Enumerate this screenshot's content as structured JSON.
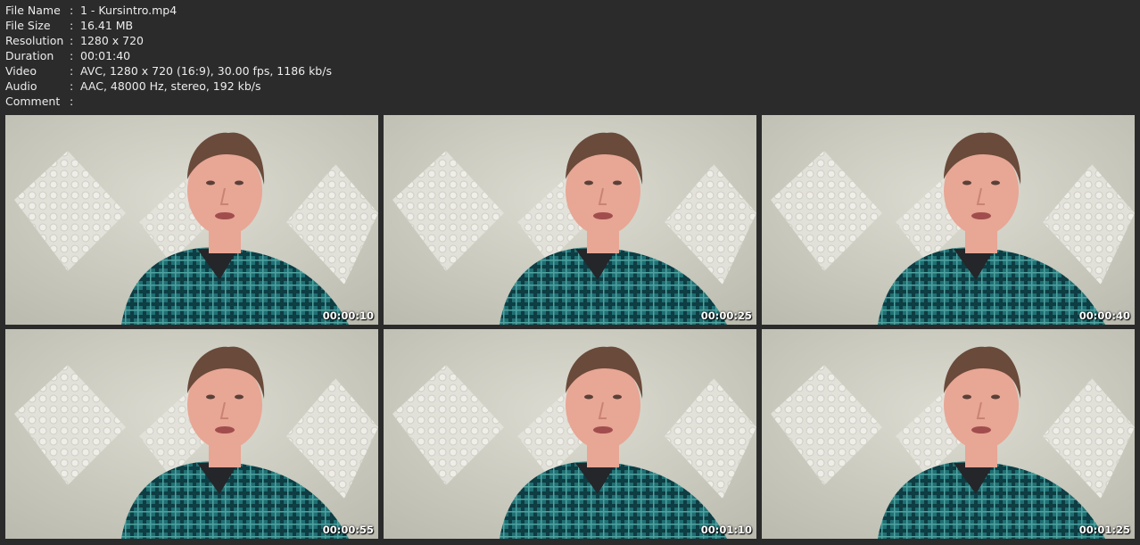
{
  "media_info": [
    {
      "key": "File Name",
      "value": "1 - Kursintro.mp4"
    },
    {
      "key": "File Size",
      "value": "16.41 MB"
    },
    {
      "key": "Resolution",
      "value": "1280 x 720"
    },
    {
      "key": "Duration",
      "value": "00:01:40"
    },
    {
      "key": "Video",
      "value": "AVC, 1280 x 720 (16:9), 30.00 fps, 1186 kb/s"
    },
    {
      "key": "Audio",
      "value": "AAC, 48000 Hz, stereo, 192 kb/s"
    },
    {
      "key": "Comment",
      "value": ""
    }
  ],
  "separator": ":",
  "thumbnails": [
    {
      "timestamp": "00:00:10"
    },
    {
      "timestamp": "00:00:25"
    },
    {
      "timestamp": "00:00:40"
    },
    {
      "timestamp": "00:00:55"
    },
    {
      "timestamp": "00:01:10"
    },
    {
      "timestamp": "00:01:25"
    }
  ],
  "colors": {
    "background": "#2b2b2b",
    "text": "#ececec",
    "wall": "#d6d7cc",
    "shirt": "#1f6f73",
    "skin": "#e8a695",
    "hair": "#6a4a3a"
  }
}
